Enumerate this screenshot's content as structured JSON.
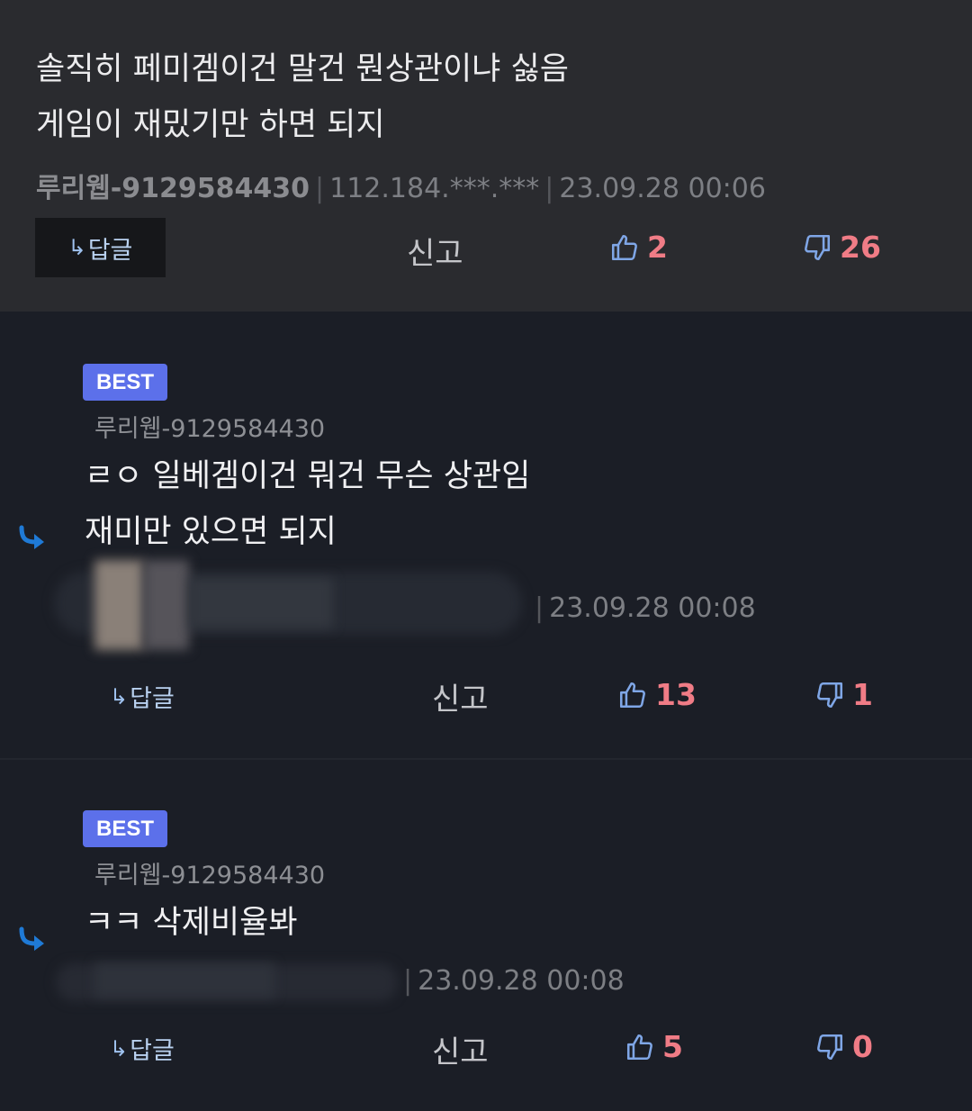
{
  "post": {
    "lines": [
      "솔직히 페미겜이건 말건 뭔상관이냐 싫음",
      "게임이 재밌기만 하면 되지"
    ],
    "author": "루리웹-9129584430",
    "ip": "112.184.***.***",
    "datetime": "23.09.28 00:06",
    "reply_label": "답글",
    "report_label": "신고",
    "upvotes": "2",
    "downvotes": "26"
  },
  "comments": [
    {
      "badge": "BEST",
      "author": "루리웹-9129584430",
      "lines": [
        "ㄹㅇ 일베겜이건 뭐건 무슨 상관임",
        "재미만 있으면 되지"
      ],
      "datetime": "23.09.28 00:08",
      "reply_label": "답글",
      "report_label": "신고",
      "upvotes": "13",
      "downvotes": "1"
    },
    {
      "badge": "BEST",
      "author": "루리웹-9129584430",
      "lines": [
        "ㅋㅋ 삭제비율봐"
      ],
      "datetime": "23.09.28 00:08",
      "reply_label": "답글",
      "report_label": "신고",
      "upvotes": "5",
      "downvotes": "0"
    }
  ],
  "colors": {
    "post_bg": "#2a2b2f",
    "page_bg": "#1b1e26",
    "badge": "#5c70ea",
    "vote_count": "#f07c86",
    "thumb_icon": "#7fa6e6",
    "reply_arrow": "#1f7ad6"
  },
  "icons": [
    "reply-arrow-icon",
    "thumbs-up-icon",
    "thumbs-down-icon",
    "reply-indent-icon"
  ]
}
